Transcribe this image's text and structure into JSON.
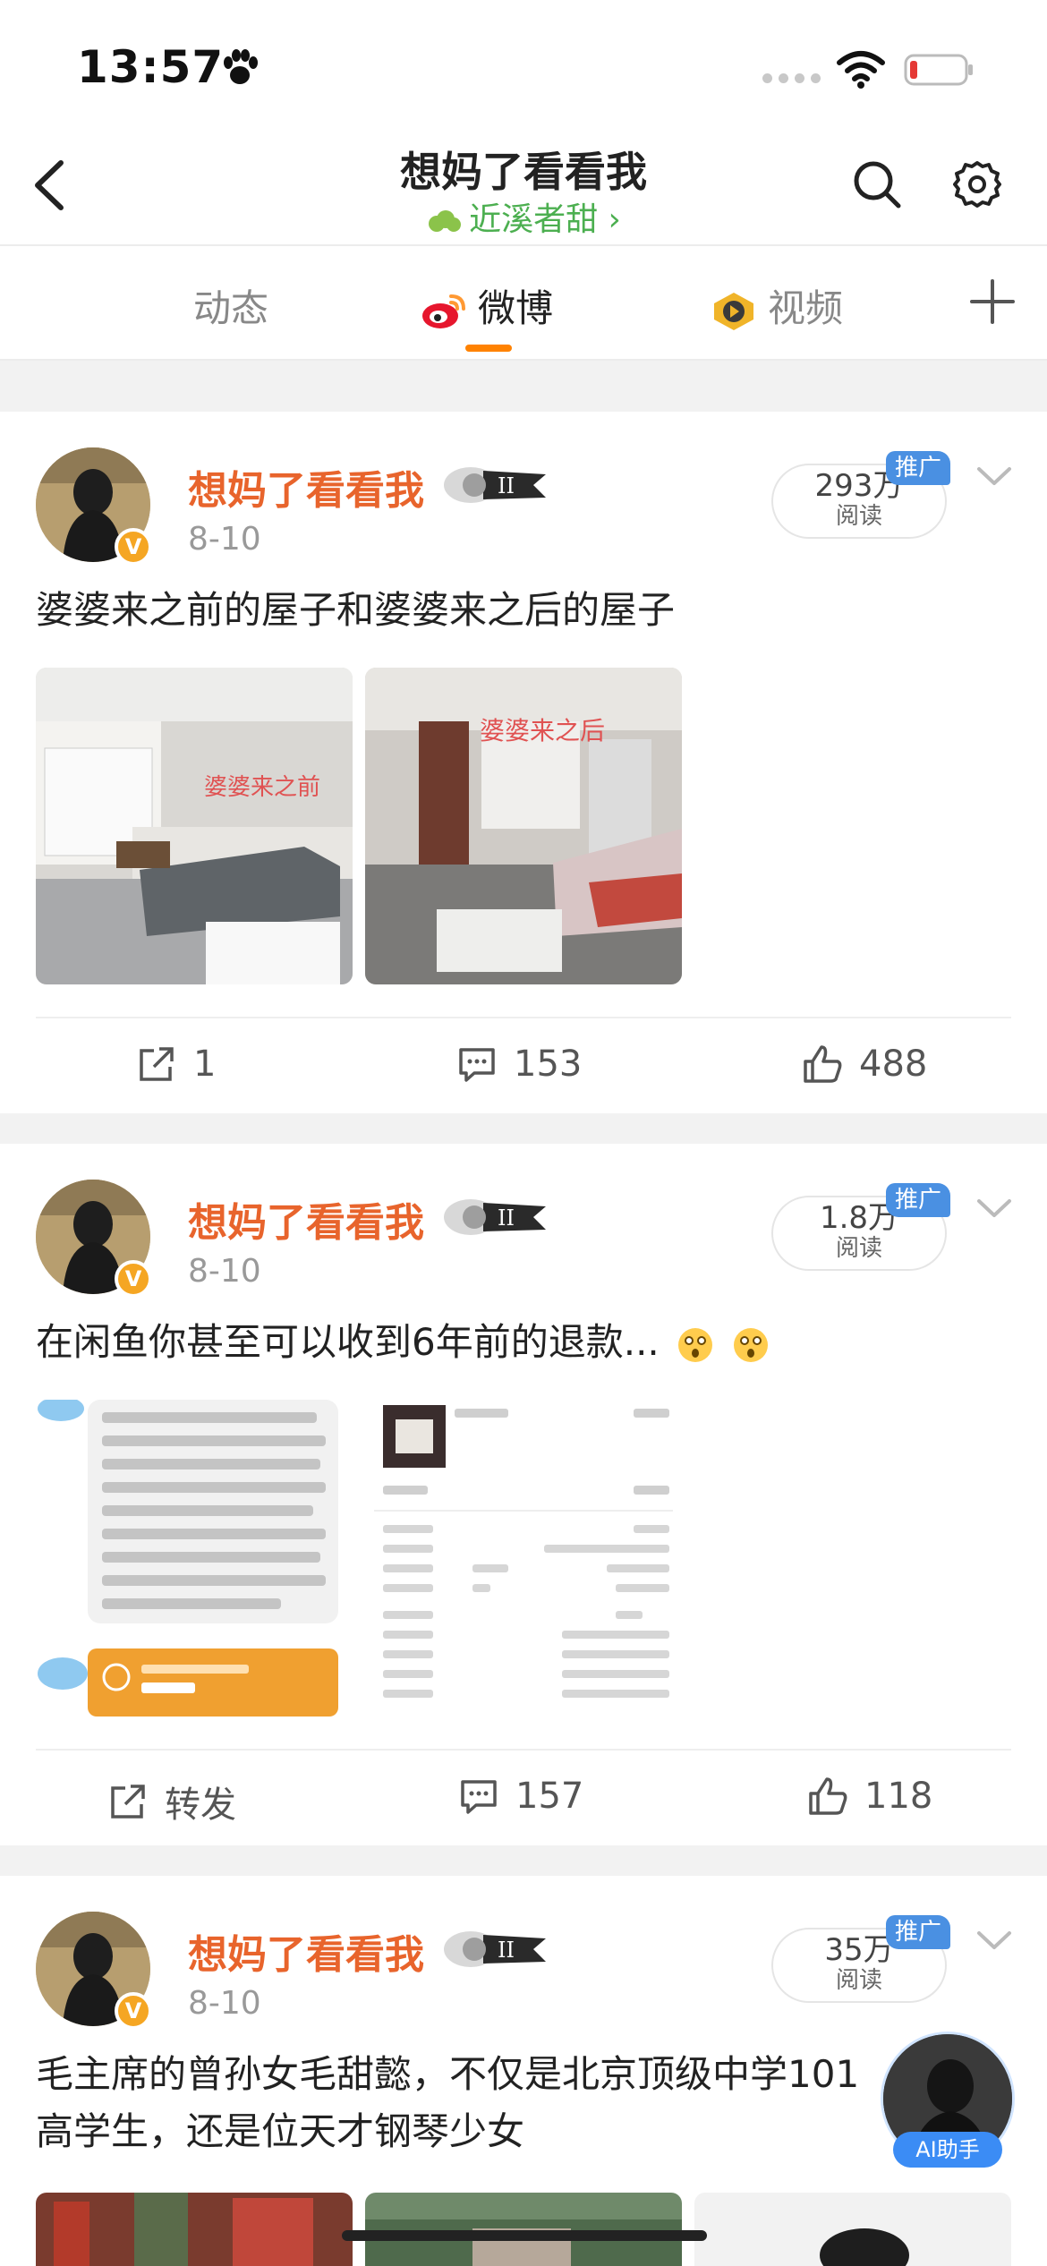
{
  "status_bar": {
    "time": "13:57"
  },
  "header": {
    "title": "想妈了看看我",
    "subtitle": "近溪者甜 ›"
  },
  "tabs": [
    {
      "label": "动态"
    },
    {
      "label": "微博"
    },
    {
      "label": "视频"
    }
  ],
  "posts": [
    {
      "author": "想妈了看看我",
      "date": "8-10",
      "reads_count": "293万",
      "reads_label": "阅读",
      "promo": "推广",
      "text": "婆婆来之前的屋子和婆婆来之后的屋子",
      "image_captions": [
        "婆婆来之前",
        "婆婆来之后"
      ],
      "repost": "1",
      "comments": "153",
      "likes": "488"
    },
    {
      "author": "想妈了看看我",
      "date": "8-10",
      "reads_count": "1.8万",
      "reads_label": "阅读",
      "promo": "推广",
      "text": "在闲鱼你甚至可以收到6年前的退款...",
      "repost": "转发",
      "comments": "157",
      "likes": "118"
    },
    {
      "author": "想妈了看看我",
      "date": "8-10",
      "reads_count": "35万",
      "reads_label": "阅读",
      "promo": "推广",
      "text": "毛主席的曾孙女毛甜懿，不仅是北京顶级中学101高学生，还是位天才钢琴少女"
    }
  ],
  "ai_assistant": {
    "label": "AI助手"
  },
  "colors": {
    "accent": "#ff8200",
    "author": "#e8642c",
    "green": "#4caf50",
    "promo": "#4a90e2"
  }
}
